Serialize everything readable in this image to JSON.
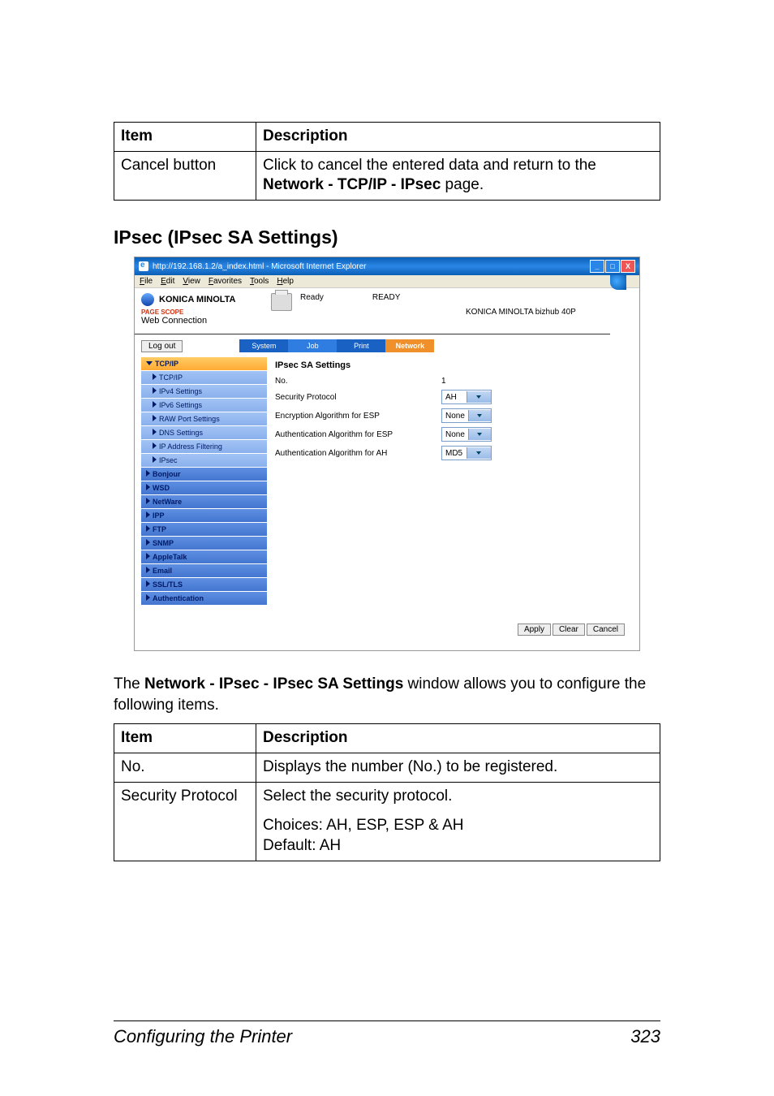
{
  "table1": {
    "h1": "Item",
    "h2": "Description",
    "r1c1": "Cancel button",
    "r1c2a": "Click to cancel the entered data and return to the ",
    "r1c2b": "Network - TCP/IP - IPsec",
    "r1c2c": " page."
  },
  "section": "IPsec (IPsec SA Settings)",
  "shot": {
    "title": "http://192.168.1.2/a_index.html - Microsoft Internet Explorer",
    "menus": [
      "File",
      "Edit",
      "View",
      "Favorites",
      "Tools",
      "Help"
    ],
    "brand": "KONICA MINOLTA",
    "pagescope_label": "PAGE SCOPE",
    "pagescope": "Web Connection",
    "ready": "Ready",
    "ready2": "READY",
    "model": "KONICA MINOLTA bizhub 40P",
    "logout": "Log out",
    "tabs": [
      "System",
      "Job",
      "Print",
      "Network"
    ],
    "sidebar": [
      {
        "t": "TCP/IP",
        "cls": "active",
        "ar": "dn"
      },
      {
        "t": "TCP/IP",
        "cls": "sub",
        "ar": "rt"
      },
      {
        "t": "IPv4 Settings",
        "cls": "sub",
        "ar": "rt"
      },
      {
        "t": "IPv6 Settings",
        "cls": "sub",
        "ar": "rt"
      },
      {
        "t": "RAW Port Settings",
        "cls": "sub",
        "ar": "rt"
      },
      {
        "t": "DNS Settings",
        "cls": "sub",
        "ar": "rt"
      },
      {
        "t": "IP Address Filtering",
        "cls": "sub",
        "ar": "rt"
      },
      {
        "t": "IPsec",
        "cls": "sub",
        "ar": "rt"
      },
      {
        "t": "Bonjour",
        "cls": "",
        "ar": "rt"
      },
      {
        "t": "WSD",
        "cls": "",
        "ar": "rt"
      },
      {
        "t": "NetWare",
        "cls": "",
        "ar": "rt"
      },
      {
        "t": "IPP",
        "cls": "",
        "ar": "rt"
      },
      {
        "t": "FTP",
        "cls": "",
        "ar": "rt"
      },
      {
        "t": "SNMP",
        "cls": "",
        "ar": "rt"
      },
      {
        "t": "AppleTalk",
        "cls": "",
        "ar": "rt"
      },
      {
        "t": "Email",
        "cls": "",
        "ar": "rt"
      },
      {
        "t": "SSL/TLS",
        "cls": "",
        "ar": "rt"
      },
      {
        "t": "Authentication",
        "cls": "",
        "ar": "rt"
      }
    ],
    "form": {
      "title": "IPsec SA Settings",
      "rows": [
        {
          "l": "No.",
          "v": "1",
          "sel": false
        },
        {
          "l": "Security Protocol",
          "v": "AH",
          "sel": true
        },
        {
          "l": "Encryption Algorithm for ESP",
          "v": "None",
          "sel": true
        },
        {
          "l": "Authentication Algorithm for ESP",
          "v": "None",
          "sel": true
        },
        {
          "l": "Authentication Algorithm for AH",
          "v": "MD5",
          "sel": true
        }
      ]
    },
    "btns": [
      "Apply",
      "Clear",
      "Cancel"
    ]
  },
  "desc": {
    "a": "The ",
    "b": "Network - IPsec - IPsec SA Settings",
    "c": " window allows you to configure the following items."
  },
  "table2": {
    "h1": "Item",
    "h2": "Description",
    "rows": [
      {
        "c1": "No.",
        "c2": "Displays the number (No.) to be registered."
      },
      {
        "c1": "Security Protocol",
        "c2a": "Select the security protocol.",
        "c2b": "Choices: AH, ESP, ESP & AH",
        "c2c": "Default:  AH"
      }
    ]
  },
  "footer": {
    "title": "Configuring the Printer",
    "page": "323"
  }
}
